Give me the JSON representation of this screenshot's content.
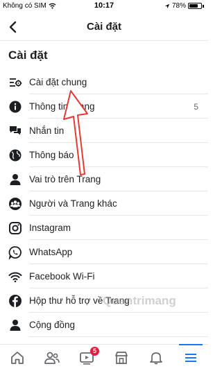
{
  "status_bar": {
    "carrier": "Không có SIM",
    "time": "10:17",
    "battery": "78%",
    "battery_level": 0.78
  },
  "header": {
    "title": "Cài đặt"
  },
  "section": {
    "title": "Cài đặt"
  },
  "menu": [
    {
      "label": "Cài đặt chung",
      "icon": "sliders-gear-icon",
      "count": ""
    },
    {
      "label": "Thông tin Trang",
      "icon": "info-icon",
      "count": "5"
    },
    {
      "label": "Nhắn tin",
      "icon": "chat-bubbles-icon",
      "count": ""
    },
    {
      "label": "Thông báo",
      "icon": "globe-icon",
      "count": ""
    },
    {
      "label": "Vai trò trên Trang",
      "icon": "person-icon",
      "count": ""
    },
    {
      "label": "Người và Trang khác",
      "icon": "people-group-icon",
      "count": ""
    },
    {
      "label": "Instagram",
      "icon": "instagram-icon",
      "count": ""
    },
    {
      "label": "WhatsApp",
      "icon": "whatsapp-icon",
      "count": ""
    },
    {
      "label": "Facebook Wi-Fi",
      "icon": "wifi-icon",
      "count": ""
    },
    {
      "label": "Hộp thư hỗ trợ về Trang",
      "icon": "facebook-icon",
      "count": ""
    },
    {
      "label": "Cộng đồng",
      "icon": "person-icon",
      "count": ""
    }
  ],
  "tabs": [
    {
      "icon": "home-icon"
    },
    {
      "icon": "friends-icon"
    },
    {
      "icon": "watch-video-icon",
      "badge": "5"
    },
    {
      "icon": "marketplace-icon"
    },
    {
      "icon": "bell-icon"
    },
    {
      "icon": "menu-icon",
      "active": true
    }
  ],
  "watermark": "Quantrimang",
  "colors": {
    "accent": "#1877f2",
    "annotation_arrow": "#e53935",
    "badge": "#e41e3f"
  }
}
